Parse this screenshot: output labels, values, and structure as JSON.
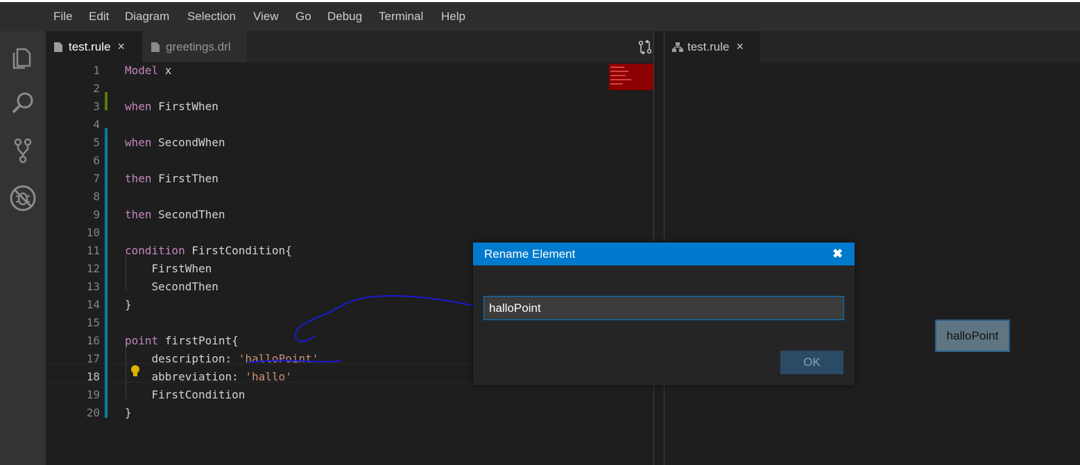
{
  "menu": [
    "File",
    "Edit",
    "Diagram",
    "Selection",
    "View",
    "Go",
    "Debug",
    "Terminal",
    "Help"
  ],
  "activity_bar": [
    "files-icon",
    "search-icon",
    "source-control-icon",
    "debug-icon"
  ],
  "left_tabs": [
    {
      "label": "test.rule",
      "active": true,
      "close": "×"
    },
    {
      "label": "greetings.drl",
      "active": false
    }
  ],
  "right_tabs": [
    {
      "label": "test.rule",
      "active": true,
      "close": "×"
    }
  ],
  "editor": {
    "lines": [
      {
        "n": "1",
        "parts": [
          [
            "Model ",
            "kw"
          ],
          [
            "x",
            ""
          ]
        ]
      },
      {
        "n": "2",
        "parts": []
      },
      {
        "n": "3",
        "parts": [
          [
            "when ",
            "kw"
          ],
          [
            "FirstWhen",
            ""
          ]
        ]
      },
      {
        "n": "4",
        "parts": []
      },
      {
        "n": "5",
        "parts": [
          [
            "when ",
            "kw"
          ],
          [
            "SecondWhen",
            ""
          ]
        ]
      },
      {
        "n": "6",
        "parts": []
      },
      {
        "n": "7",
        "parts": [
          [
            "then ",
            "kw"
          ],
          [
            "FirstThen",
            ""
          ]
        ]
      },
      {
        "n": "8",
        "parts": []
      },
      {
        "n": "9",
        "parts": [
          [
            "then ",
            "kw"
          ],
          [
            "SecondThen",
            ""
          ]
        ]
      },
      {
        "n": "10",
        "parts": []
      },
      {
        "n": "11",
        "parts": [
          [
            "condition ",
            "kw"
          ],
          [
            "FirstCondition{",
            ""
          ]
        ]
      },
      {
        "n": "12",
        "parts": [
          [
            "    FirstWhen",
            ""
          ]
        ]
      },
      {
        "n": "13",
        "parts": [
          [
            "    SecondThen",
            ""
          ]
        ]
      },
      {
        "n": "14",
        "parts": [
          [
            "}",
            ""
          ]
        ]
      },
      {
        "n": "15",
        "parts": []
      },
      {
        "n": "16",
        "parts": [
          [
            "point ",
            "kw"
          ],
          [
            "firstPoint{",
            ""
          ]
        ]
      },
      {
        "n": "17",
        "parts": [
          [
            "    description: ",
            ""
          ],
          [
            "'halloPoint'",
            "str"
          ]
        ]
      },
      {
        "n": "18",
        "parts": [
          [
            "    abbreviation: ",
            ""
          ],
          [
            "'hallo'",
            "str"
          ]
        ]
      },
      {
        "n": "19",
        "parts": [
          [
            "    FirstCondition",
            ""
          ]
        ]
      },
      {
        "n": "20",
        "parts": [
          [
            "}",
            ""
          ]
        ]
      }
    ],
    "active_line": "18"
  },
  "dialog": {
    "title": "Rename Element",
    "close_glyph": "✖",
    "value": "halloPoint",
    "ok_label": "OK"
  },
  "diagram": {
    "node_label": "halloPoint"
  },
  "colors": {
    "accent": "#007acc",
    "keyword": "#c586c0",
    "string": "#ce9178"
  }
}
